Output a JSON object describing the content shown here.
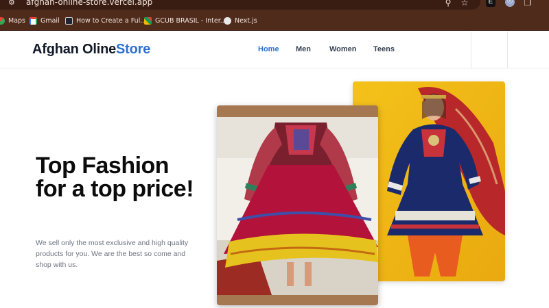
{
  "browser": {
    "url": "afghan-online-store.vercel.app",
    "icons": [
      "site-info-icon",
      "zoom-icon",
      "star-icon",
      "extension-icon",
      "shield-icon",
      "puzzle-icon"
    ],
    "chrome_color": "#4f2b1c",
    "bookmarks": [
      {
        "label": "Maps",
        "icon": "maps-icon"
      },
      {
        "label": "Gmail",
        "icon": "gmail-icon"
      },
      {
        "label": "How to Create a Ful...",
        "icon": "dev-icon"
      },
      {
        "label": "GCUB BRASIL - Inter...",
        "icon": "gcub-icon"
      },
      {
        "label": "Next.js",
        "icon": "globe-icon"
      }
    ]
  },
  "header": {
    "brand_main": "Afghan Oline",
    "brand_accent": "Store",
    "accent_color": "#2f6fd0",
    "nav": [
      "Home",
      "Men",
      "Women",
      "Teens"
    ],
    "active_nav": "Home"
  },
  "hero": {
    "title": "Top Fashion for a top price!",
    "description": "We sell only the most exclusive and high quality products for you. We are the best so come and shop with us."
  }
}
